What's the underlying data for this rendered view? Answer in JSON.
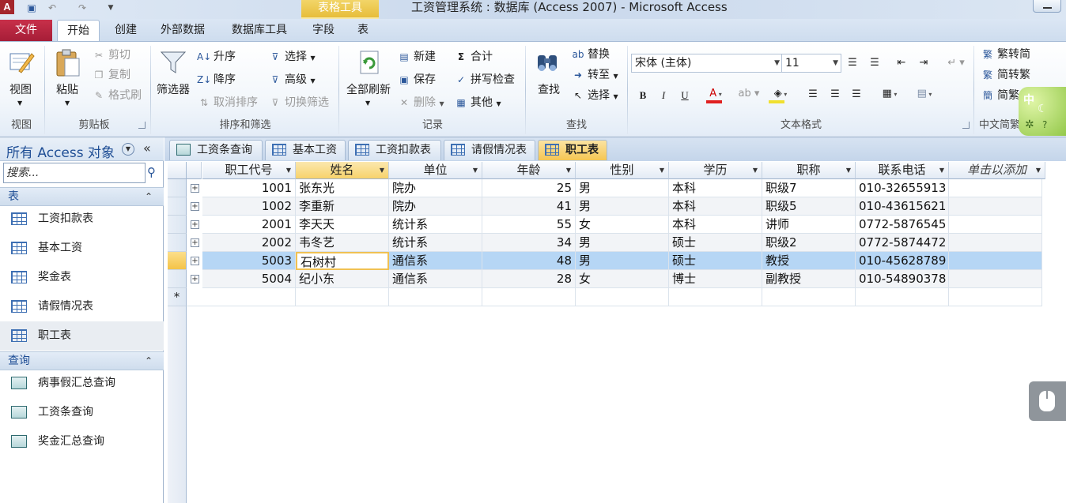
{
  "window": {
    "title": "工资管理系统 : 数据库 (Access 2007) - Microsoft Access",
    "app_icon": "A",
    "context_tab": "表格工具"
  },
  "ribbon_tabs": [
    "文件",
    "开始",
    "创建",
    "外部数据",
    "数据库工具",
    "字段",
    "表"
  ],
  "groups": {
    "view": {
      "label": "视图",
      "button": "视图"
    },
    "clipboard": {
      "label": "剪贴板",
      "paste": "粘贴",
      "cut": "剪切",
      "copy": "复制",
      "format_painter": "格式刷"
    },
    "sort_filter": {
      "label": "排序和筛选",
      "filter": "筛选器",
      "ascending": "升序",
      "descending": "降序",
      "clear_sort": "取消排序",
      "selection": "选择",
      "advanced": "高级",
      "toggle_filter": "切换筛选"
    },
    "records": {
      "label": "记录",
      "refresh_all": "全部刷新",
      "new": "新建",
      "save": "保存",
      "delete": "删除",
      "totals": "合计",
      "spelling": "拼写检查",
      "more": "其他"
    },
    "find": {
      "label": "查找",
      "find": "查找",
      "replace": "替换",
      "goto": "转至",
      "select": "选择"
    },
    "text_format": {
      "label": "文本格式",
      "font": "宋体 (主体)",
      "size": "11"
    },
    "chinese": {
      "label": "中文简繁",
      "to_trad": "繁转简",
      "to_simp": "简转繁",
      "conv": "简繁"
    }
  },
  "nav": {
    "title": "所有 Access 对象",
    "search_placeholder": "搜索...",
    "tables_header": "表",
    "tables": [
      "工资扣款表",
      "基本工资",
      "奖金表",
      "请假情况表",
      "职工表"
    ],
    "queries_header": "查询",
    "queries": [
      "病事假汇总查询",
      "工资条查询",
      "奖金汇总查询"
    ]
  },
  "doc_tabs": [
    {
      "label": "工资条查询",
      "type": "query"
    },
    {
      "label": "基本工资",
      "type": "table"
    },
    {
      "label": "工资扣款表",
      "type": "table"
    },
    {
      "label": "请假情况表",
      "type": "table"
    },
    {
      "label": "职工表",
      "type": "table"
    }
  ],
  "datasheet": {
    "columns": [
      "职工代号",
      "姓名",
      "单位",
      "年龄",
      "性别",
      "学历",
      "职称",
      "联系电话",
      "单击以添加"
    ],
    "rows": [
      [
        "1001",
        "张东光",
        "院办",
        "25",
        "男",
        "本科",
        "职级7",
        "010-32655913"
      ],
      [
        "1002",
        "李重新",
        "院办",
        "41",
        "男",
        "本科",
        "职级5",
        "010-43615621"
      ],
      [
        "2001",
        "李天天",
        "统计系",
        "55",
        "女",
        "本科",
        "讲师",
        "0772-5876545"
      ],
      [
        "2002",
        "韦冬艺",
        "统计系",
        "34",
        "男",
        "硕士",
        "职级2",
        "0772-5874472"
      ],
      [
        "5003",
        "石树村",
        "通信系",
        "48",
        "男",
        "硕士",
        "教授",
        "010-45628789"
      ],
      [
        "5004",
        "纪小东",
        "通信系",
        "28",
        "女",
        "博士",
        "副教授",
        "010-54890378"
      ]
    ],
    "selected_row": 4,
    "new_row_marker": "*"
  },
  "ime": {
    "label": "中"
  }
}
